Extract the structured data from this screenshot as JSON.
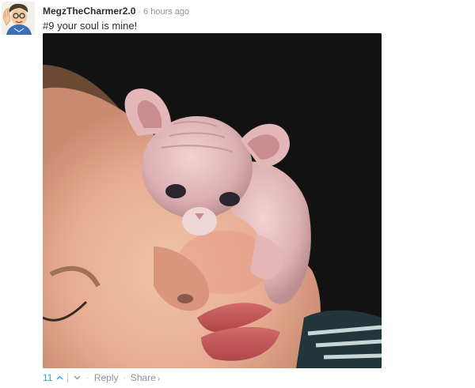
{
  "comment": {
    "username": "MegzTheCharmer2.0",
    "separator": "·",
    "timestamp": "6 hours ago",
    "text": "#9 your soul is mine!",
    "votes": "11",
    "actions": {
      "reply": "Reply",
      "share": "Share",
      "share_caret": "›",
      "dot": "·"
    }
  },
  "colors": {
    "username": "#2a2e2e",
    "meta": "#8a949b",
    "vote_accent": "#2e9fff",
    "photo_background": "#121212"
  },
  "icons": {
    "avatar": "cartoon-avatar",
    "upvote": "chevron-up-icon",
    "downvote": "chevron-down-icon"
  }
}
